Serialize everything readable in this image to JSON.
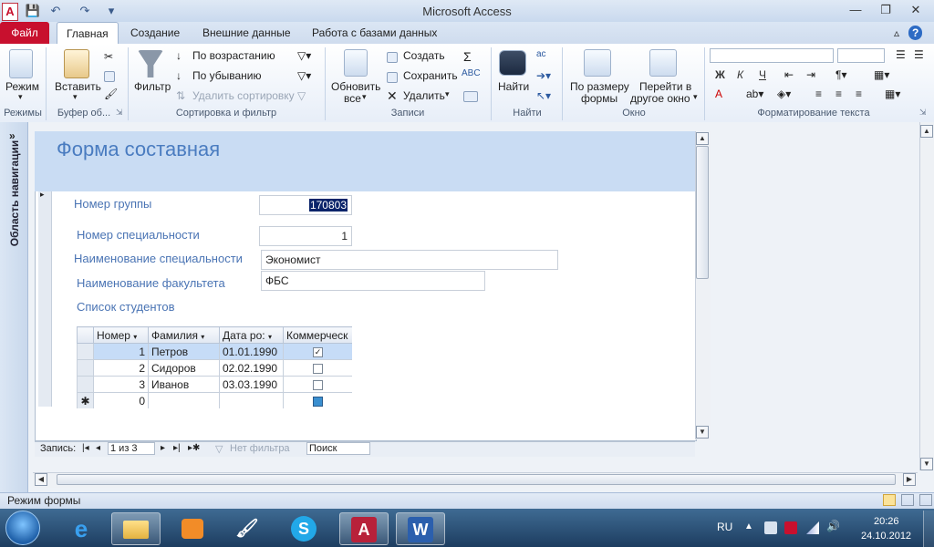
{
  "window": {
    "title": "Microsoft Access",
    "min": "—",
    "restore": "❐",
    "close": "✕"
  },
  "quick_access": {
    "app_icon": "A",
    "save": "💾",
    "undo": "↶",
    "redo": "↷",
    "customize": "▾"
  },
  "help": {
    "caret": "▵",
    "question": "?"
  },
  "tabs": [
    "Файл",
    "Главная",
    "Создание",
    "Внешние данные",
    "Работа с базами данных"
  ],
  "ribbon": {
    "groups": {
      "views": "Режимы",
      "clipboard": "Буфер об...",
      "sort_filter": "Сортировка и фильтр",
      "records": "Записи",
      "find": "Найти",
      "window": "Окно",
      "text_format": "Форматирование текста"
    },
    "view_btn": "Режим",
    "paste_btn": "Вставить",
    "filter_btn": "Фильтр",
    "sort_asc": "По возрастанию",
    "sort_desc": "По убыванию",
    "clear_sort": "Удалить сортировку",
    "refresh_l1": "Обновить",
    "refresh_l2": "все",
    "create_rec": "Создать",
    "save_rec": "Сохранить",
    "delete_rec": "Удалить",
    "find_btn": "Найти",
    "fit_l1": "По размеру",
    "fit_l2": "формы",
    "switch_l1": "Перейти в",
    "switch_l2": "другое окно",
    "bold": "Ж",
    "italic": "К",
    "underline": "Ч",
    "font_color": "A"
  },
  "nav_pane": {
    "label": "Область навигации",
    "toggle": "»"
  },
  "form": {
    "title": "Форма составная",
    "fields": {
      "group_no": {
        "label": "Номер группы",
        "value": "170803"
      },
      "spec_no": {
        "label": "Номер специальности",
        "value": "1"
      },
      "spec_name": {
        "label": "Наименование специальности",
        "value": "Экономист"
      },
      "faculty": {
        "label": "Наименование факультета",
        "value": "ФБС"
      },
      "students": {
        "label": "Список студентов"
      }
    },
    "subform": {
      "columns": [
        "Номер",
        "Фамилия",
        "Дата ро:",
        "Коммерческ"
      ],
      "rows": [
        {
          "no": "1",
          "surname": "Петров",
          "date": "01.01.1990",
          "commercial": true
        },
        {
          "no": "2",
          "surname": "Сидоров",
          "date": "02.02.1990",
          "commercial": false
        },
        {
          "no": "3",
          "surname": "Иванов",
          "date": "03.03.1990",
          "commercial": false
        }
      ],
      "new_row": {
        "marker": "✱",
        "no": "0"
      }
    },
    "record_nav": {
      "label": "Запись:",
      "position": "1 из 3",
      "filter": "Нет фильтра",
      "search": "Поиск"
    }
  },
  "status": {
    "text": "Режим формы"
  },
  "taskbar": {
    "lang": "RU",
    "time": "20:26",
    "date": "24.10.2012"
  },
  "colors": {
    "file_tab": "#c8102e",
    "form_header": "#c9dcf3",
    "label_blue": "#4a74b4",
    "title_blue": "#4a7cc0"
  }
}
